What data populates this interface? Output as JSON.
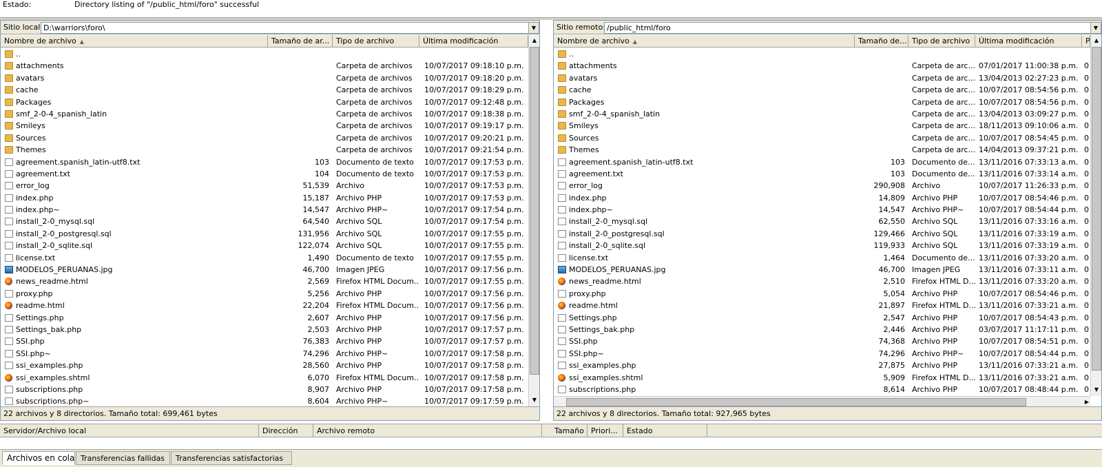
{
  "log": {
    "label": "Estado:",
    "message": "Directory listing of \"/public_html/foro\" successful"
  },
  "local": {
    "label": "Sitio local:",
    "path": "D:\\warriors\\foro\\",
    "columns": [
      "Nombre de archivo",
      "Tamaño de ar...",
      "Tipo de archivo",
      "Última modificación"
    ],
    "status": "22 archivos y 8 directorios. Tamaño total: 699,461 bytes",
    "rows": [
      {
        "icon": "folder",
        "name": "..",
        "size": "",
        "type": "",
        "date": ""
      },
      {
        "icon": "folder",
        "name": "attachments",
        "size": "",
        "type": "Carpeta de archivos",
        "date": "10/07/2017 09:18:10 p.m."
      },
      {
        "icon": "folder",
        "name": "avatars",
        "size": "",
        "type": "Carpeta de archivos",
        "date": "10/07/2017 09:18:20 p.m."
      },
      {
        "icon": "folder",
        "name": "cache",
        "size": "",
        "type": "Carpeta de archivos",
        "date": "10/07/2017 09:18:29 p.m."
      },
      {
        "icon": "folder",
        "name": "Packages",
        "size": "",
        "type": "Carpeta de archivos",
        "date": "10/07/2017 09:12:48 p.m."
      },
      {
        "icon": "folder",
        "name": "smf_2-0-4_spanish_latin",
        "size": "",
        "type": "Carpeta de archivos",
        "date": "10/07/2017 09:18:38 p.m."
      },
      {
        "icon": "folder",
        "name": "Smileys",
        "size": "",
        "type": "Carpeta de archivos",
        "date": "10/07/2017 09:19:17 p.m."
      },
      {
        "icon": "folder",
        "name": "Sources",
        "size": "",
        "type": "Carpeta de archivos",
        "date": "10/07/2017 09:20:21 p.m."
      },
      {
        "icon": "folder",
        "name": "Themes",
        "size": "",
        "type": "Carpeta de archivos",
        "date": "10/07/2017 09:21:54 p.m."
      },
      {
        "icon": "file",
        "name": "agreement.spanish_latin-utf8.txt",
        "size": "103",
        "type": "Documento de texto",
        "date": "10/07/2017 09:17:53 p.m."
      },
      {
        "icon": "file",
        "name": "agreement.txt",
        "size": "104",
        "type": "Documento de texto",
        "date": "10/07/2017 09:17:53 p.m."
      },
      {
        "icon": "file",
        "name": "error_log",
        "size": "51,539",
        "type": "Archivo",
        "date": "10/07/2017 09:17:53 p.m."
      },
      {
        "icon": "file",
        "name": "index.php",
        "size": "15,187",
        "type": "Archivo PHP",
        "date": "10/07/2017 09:17:53 p.m."
      },
      {
        "icon": "file",
        "name": "index.php~",
        "size": "14,547",
        "type": "Archivo PHP~",
        "date": "10/07/2017 09:17:54 p.m."
      },
      {
        "icon": "file",
        "name": "install_2-0_mysql.sql",
        "size": "64,540",
        "type": "Archivo SQL",
        "date": "10/07/2017 09:17:54 p.m."
      },
      {
        "icon": "file",
        "name": "install_2-0_postgresql.sql",
        "size": "131,956",
        "type": "Archivo SQL",
        "date": "10/07/2017 09:17:55 p.m."
      },
      {
        "icon": "file",
        "name": "install_2-0_sqlite.sql",
        "size": "122,074",
        "type": "Archivo SQL",
        "date": "10/07/2017 09:17:55 p.m."
      },
      {
        "icon": "file",
        "name": "license.txt",
        "size": "1,490",
        "type": "Documento de texto",
        "date": "10/07/2017 09:17:55 p.m."
      },
      {
        "icon": "image",
        "name": "MODELOS_PERUANAS.jpg",
        "size": "46,700",
        "type": "Imagen JPEG",
        "date": "10/07/2017 09:17:56 p.m."
      },
      {
        "icon": "firefox",
        "name": "news_readme.html",
        "size": "2,569",
        "type": "Firefox HTML Docum...",
        "date": "10/07/2017 09:17:55 p.m."
      },
      {
        "icon": "file",
        "name": "proxy.php",
        "size": "5,256",
        "type": "Archivo PHP",
        "date": "10/07/2017 09:17:56 p.m."
      },
      {
        "icon": "firefox",
        "name": "readme.html",
        "size": "22,204",
        "type": "Firefox HTML Docum...",
        "date": "10/07/2017 09:17:56 p.m."
      },
      {
        "icon": "file",
        "name": "Settings.php",
        "size": "2,607",
        "type": "Archivo PHP",
        "date": "10/07/2017 09:17:56 p.m."
      },
      {
        "icon": "file",
        "name": "Settings_bak.php",
        "size": "2,503",
        "type": "Archivo PHP",
        "date": "10/07/2017 09:17:57 p.m."
      },
      {
        "icon": "file",
        "name": "SSI.php",
        "size": "76,383",
        "type": "Archivo PHP",
        "date": "10/07/2017 09:17:57 p.m."
      },
      {
        "icon": "file",
        "name": "SSI.php~",
        "size": "74,296",
        "type": "Archivo PHP~",
        "date": "10/07/2017 09:17:58 p.m."
      },
      {
        "icon": "file",
        "name": "ssi_examples.php",
        "size": "28,560",
        "type": "Archivo PHP",
        "date": "10/07/2017 09:17:58 p.m."
      },
      {
        "icon": "firefox",
        "name": "ssi_examples.shtml",
        "size": "6,070",
        "type": "Firefox HTML Docum...",
        "date": "10/07/2017 09:17:58 p.m."
      },
      {
        "icon": "file",
        "name": "subscriptions.php",
        "size": "8,907",
        "type": "Archivo PHP",
        "date": "10/07/2017 09:17:58 p.m."
      },
      {
        "icon": "file",
        "name": "subscriptions.php~",
        "size": "8,604",
        "type": "Archivo PHP~",
        "date": "10/07/2017 09:17:59 p.m."
      }
    ]
  },
  "remote": {
    "label": "Sitio remoto:",
    "path": "/public_html/foro",
    "columns": [
      "Nombre de archivo",
      "Tamaño de...",
      "Tipo de archivo",
      "Última modificación",
      "P"
    ],
    "status": "22 archivos y 8 directorios. Tamaño total: 927,965 bytes",
    "rows": [
      {
        "icon": "folder",
        "name": "..",
        "size": "",
        "type": "",
        "date": "",
        "perm": ""
      },
      {
        "icon": "folder",
        "name": "attachments",
        "size": "",
        "type": "Carpeta de arc...",
        "date": "07/01/2017 11:00:38 p.m.",
        "perm": "0"
      },
      {
        "icon": "folder",
        "name": "avatars",
        "size": "",
        "type": "Carpeta de arc...",
        "date": "13/04/2013 02:27:23 p.m.",
        "perm": "0"
      },
      {
        "icon": "folder",
        "name": "cache",
        "size": "",
        "type": "Carpeta de arc...",
        "date": "10/07/2017 08:54:56 p.m.",
        "perm": "0"
      },
      {
        "icon": "folder",
        "name": "Packages",
        "size": "",
        "type": "Carpeta de arc...",
        "date": "10/07/2017 08:54:56 p.m.",
        "perm": "0"
      },
      {
        "icon": "folder",
        "name": "smf_2-0-4_spanish_latin",
        "size": "",
        "type": "Carpeta de arc...",
        "date": "13/04/2013 03:09:27 p.m.",
        "perm": "0"
      },
      {
        "icon": "folder",
        "name": "Smileys",
        "size": "",
        "type": "Carpeta de arc...",
        "date": "18/11/2013 09:10:06 a.m.",
        "perm": "0"
      },
      {
        "icon": "folder",
        "name": "Sources",
        "size": "",
        "type": "Carpeta de arc...",
        "date": "10/07/2017 08:54:45 p.m.",
        "perm": "0"
      },
      {
        "icon": "folder",
        "name": "Themes",
        "size": "",
        "type": "Carpeta de arc...",
        "date": "14/04/2013 09:37:21 p.m.",
        "perm": "0"
      },
      {
        "icon": "file",
        "name": "agreement.spanish_latin-utf8.txt",
        "size": "103",
        "type": "Documento de...",
        "date": "13/11/2016 07:33:13 a.m.",
        "perm": "0"
      },
      {
        "icon": "file",
        "name": "agreement.txt",
        "size": "103",
        "type": "Documento de...",
        "date": "13/11/2016 07:33:14 a.m.",
        "perm": "0"
      },
      {
        "icon": "file",
        "name": "error_log",
        "size": "290,908",
        "type": "Archivo",
        "date": "10/07/2017 11:26:33 p.m.",
        "perm": "0"
      },
      {
        "icon": "file",
        "name": "index.php",
        "size": "14,809",
        "type": "Archivo PHP",
        "date": "10/07/2017 08:54:46 p.m.",
        "perm": "0"
      },
      {
        "icon": "file",
        "name": "index.php~",
        "size": "14,547",
        "type": "Archivo PHP~",
        "date": "10/07/2017 08:54:44 p.m.",
        "perm": "0"
      },
      {
        "icon": "file",
        "name": "install_2-0_mysql.sql",
        "size": "62,550",
        "type": "Archivo SQL",
        "date": "13/11/2016 07:33:16 a.m.",
        "perm": "0"
      },
      {
        "icon": "file",
        "name": "install_2-0_postgresql.sql",
        "size": "129,466",
        "type": "Archivo SQL",
        "date": "13/11/2016 07:33:19 a.m.",
        "perm": "0"
      },
      {
        "icon": "file",
        "name": "install_2-0_sqlite.sql",
        "size": "119,933",
        "type": "Archivo SQL",
        "date": "13/11/2016 07:33:19 a.m.",
        "perm": "0"
      },
      {
        "icon": "file",
        "name": "license.txt",
        "size": "1,464",
        "type": "Documento de...",
        "date": "13/11/2016 07:33:20 a.m.",
        "perm": "0"
      },
      {
        "icon": "image",
        "name": "MODELOS_PERUANAS.jpg",
        "size": "46,700",
        "type": "Imagen JPEG",
        "date": "13/11/2016 07:33:11 a.m.",
        "perm": "0"
      },
      {
        "icon": "firefox",
        "name": "news_readme.html",
        "size": "2,510",
        "type": "Firefox HTML D...",
        "date": "13/11/2016 07:33:20 a.m.",
        "perm": "0"
      },
      {
        "icon": "file",
        "name": "proxy.php",
        "size": "5,054",
        "type": "Archivo PHP",
        "date": "10/07/2017 08:54:46 p.m.",
        "perm": "0"
      },
      {
        "icon": "firefox",
        "name": "readme.html",
        "size": "21,897",
        "type": "Firefox HTML D...",
        "date": "13/11/2016 07:33:21 a.m.",
        "perm": "0"
      },
      {
        "icon": "file",
        "name": "Settings.php",
        "size": "2,547",
        "type": "Archivo PHP",
        "date": "10/07/2017 08:54:43 p.m.",
        "perm": "0"
      },
      {
        "icon": "file",
        "name": "Settings_bak.php",
        "size": "2,446",
        "type": "Archivo PHP",
        "date": "03/07/2017 11:17:11 p.m.",
        "perm": "0"
      },
      {
        "icon": "file",
        "name": "SSI.php",
        "size": "74,368",
        "type": "Archivo PHP",
        "date": "10/07/2017 08:54:51 p.m.",
        "perm": "0"
      },
      {
        "icon": "file",
        "name": "SSI.php~",
        "size": "74,296",
        "type": "Archivo PHP~",
        "date": "10/07/2017 08:54:44 p.m.",
        "perm": "0"
      },
      {
        "icon": "file",
        "name": "ssi_examples.php",
        "size": "27,875",
        "type": "Archivo PHP",
        "date": "13/11/2016 07:33:21 a.m.",
        "perm": "0"
      },
      {
        "icon": "firefox",
        "name": "ssi_examples.shtml",
        "size": "5,909",
        "type": "Firefox HTML D...",
        "date": "13/11/2016 07:33:21 a.m.",
        "perm": "0"
      },
      {
        "icon": "file",
        "name": "subscriptions.php",
        "size": "8,614",
        "type": "Archivo PHP",
        "date": "10/07/2017 08:48:44 p.m.",
        "perm": "0"
      }
    ]
  },
  "queue": {
    "columns": [
      "Servidor/Archivo local",
      "Dirección",
      "Archivo remoto",
      "Tamaño",
      "Priori...",
      "Estado"
    ]
  },
  "tabs": [
    "Archivos en cola",
    "Transferencias fallidas",
    "Transferencias satisfactorias"
  ]
}
